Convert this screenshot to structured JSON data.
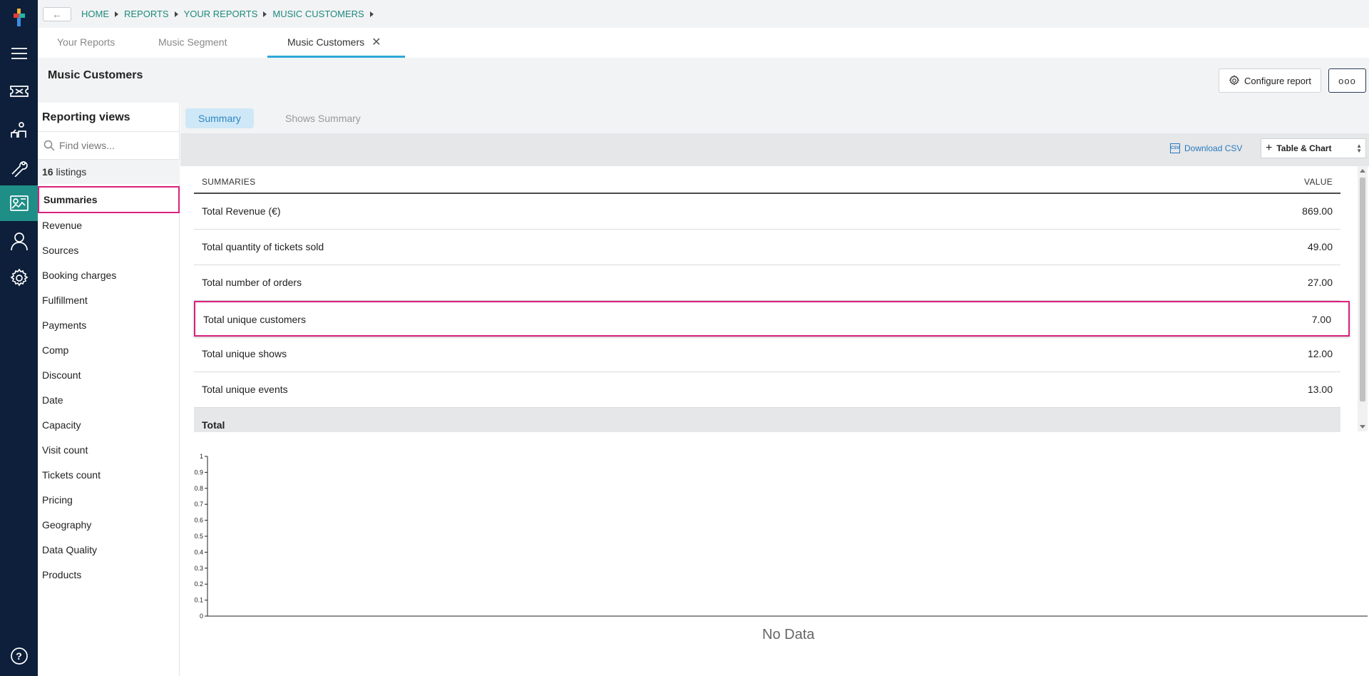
{
  "breadcrumb": [
    "HOME",
    "REPORTS",
    "YOUR REPORTS",
    "MUSIC CUSTOMERS"
  ],
  "tabs": [
    {
      "label": "Your Reports"
    },
    {
      "label": "Music Segment"
    },
    {
      "label": "Music Customers",
      "active": true
    }
  ],
  "header": {
    "title": "Music Customers",
    "configure_label": "Configure report",
    "more_label": "ooo"
  },
  "sidebar": {
    "title": "Reporting views",
    "search_placeholder": "Find views...",
    "listings_count": "16",
    "listings_label": "listings",
    "items": [
      "Summaries",
      "Revenue",
      "Sources",
      "Booking charges",
      "Fulfillment",
      "Payments",
      "Comp",
      "Discount",
      "Date",
      "Capacity",
      "Visit count",
      "Tickets count",
      "Pricing",
      "Geography",
      "Data Quality",
      "Products"
    ],
    "selected": "Summaries"
  },
  "subtabs": [
    {
      "label": "Summary",
      "active": true
    },
    {
      "label": "Shows Summary"
    }
  ],
  "toolbar": {
    "csv_icon_text": "CSV",
    "download_label": "Download CSV",
    "view_mode": "Table & Chart"
  },
  "table": {
    "headers": [
      "SUMMARIES",
      "VALUE"
    ],
    "rows": [
      {
        "label": "Total Revenue (€)",
        "value": "869.00"
      },
      {
        "label": "Total quantity of tickets sold",
        "value": "49.00"
      },
      {
        "label": "Total number of orders",
        "value": "27.00"
      },
      {
        "label": "Total unique customers",
        "value": "7.00",
        "highlighted": true
      },
      {
        "label": "Total unique shows",
        "value": "12.00"
      },
      {
        "label": "Total unique events",
        "value": "13.00"
      }
    ],
    "total_label": "Total"
  },
  "chart_data": {
    "type": "bar",
    "categories": [],
    "values": [],
    "ylim": [
      0,
      1
    ],
    "yticks": [
      "0",
      "0.1",
      "0.2",
      "0.3",
      "0.4",
      "0.5",
      "0.6",
      "0.7",
      "0.8",
      "0.9",
      "1"
    ],
    "message": "No Data"
  },
  "help_label": "?",
  "colors": {
    "rail": "#0d1f3a",
    "rail_active": "#1f8e86",
    "accent": "#2ea7d8",
    "highlight": "#d9217e",
    "link": "#1e8a7e"
  }
}
